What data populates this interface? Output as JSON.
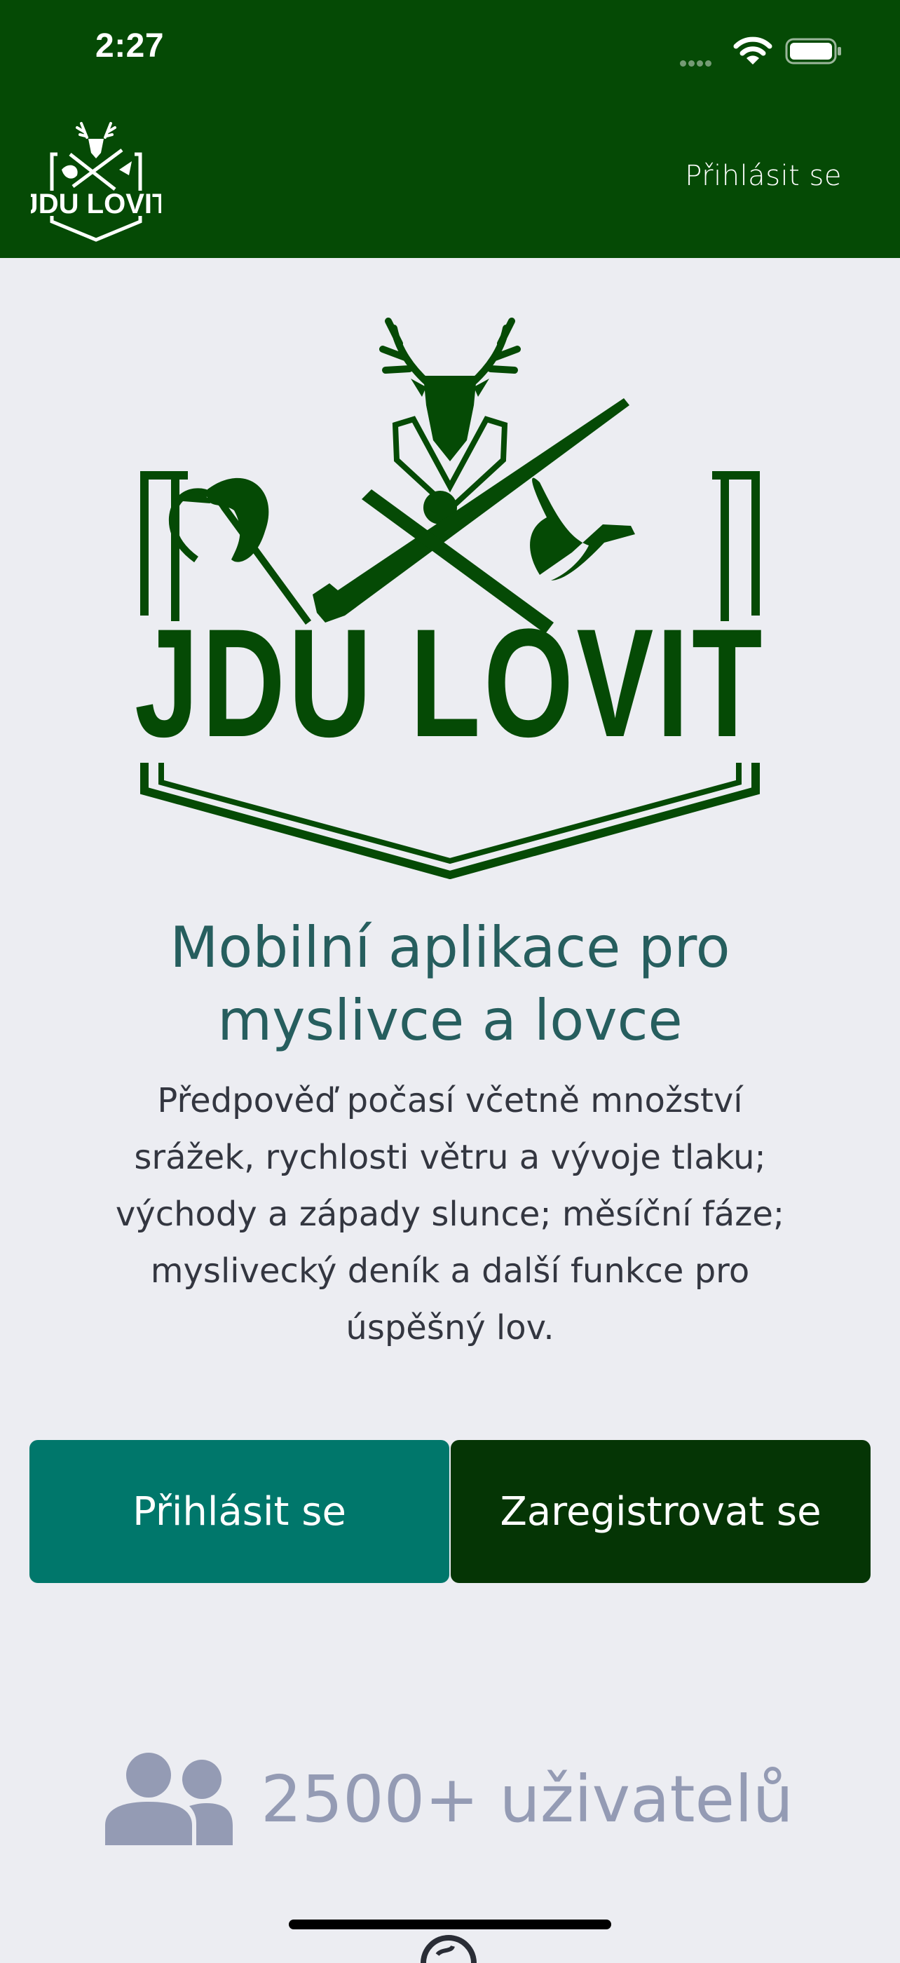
{
  "status_bar": {
    "time": "2:27"
  },
  "header": {
    "logo_text": "JDU LOVIT",
    "login_link": "Přihlásit se"
  },
  "hero": {
    "logo_text": "JDU LOVIT",
    "title_line1": "Mobilní aplikace pro",
    "title_line2": "myslivce a lovce",
    "description_lines": [
      "Předpověď počasí včetně množství",
      "srážek, rychlosti větru a vývoje tlaku;",
      "východy a západy slunce; měsíční fáze;",
      "myslivecký deník a další funkce pro",
      "úspěšný lov."
    ]
  },
  "buttons": {
    "login": "Přihlásit se",
    "register": "Zaregistrovat se"
  },
  "stats": {
    "users": "2500+ uživatelů"
  },
  "colors": {
    "header_bg": "#054a05",
    "brand_green": "#054a05",
    "login_button": "#00776b",
    "register_button": "#053505",
    "title": "#265e5e",
    "muted": "#949bb4",
    "page_bg": "#ecedf2"
  },
  "icons": [
    "cellular-signal-icon",
    "wifi-icon",
    "battery-icon",
    "users-icon",
    "globe-icon"
  ]
}
